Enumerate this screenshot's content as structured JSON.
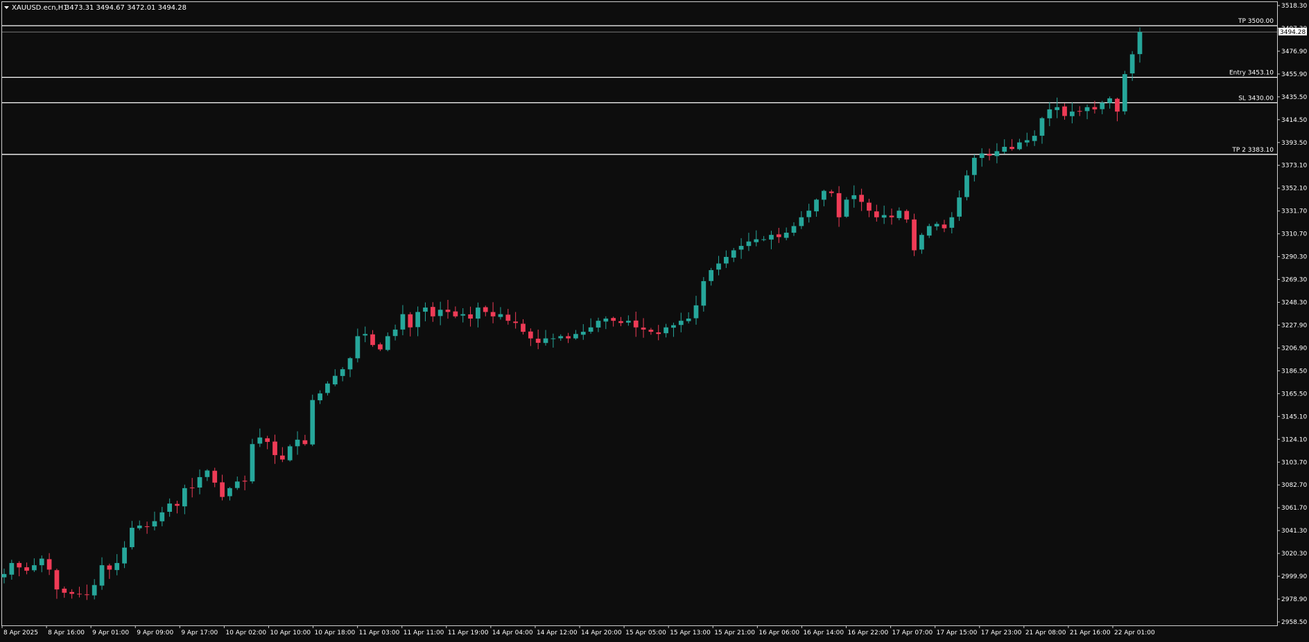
{
  "header": {
    "symbol": "XAUUSD.ecn,H1",
    "ohlc": "3473.31 3494.67 3472.01 3494.28"
  },
  "price_tag": "3494.28",
  "colors": {
    "background": "#0d0d0d",
    "bull": "#26a69a",
    "bear": "#ef3b56",
    "level_line": "#ffffff",
    "text": "#ffffff"
  },
  "chart_data": {
    "type": "candlestick",
    "symbol": "XAUUSD.ecn",
    "timeframe": "H1",
    "ylim": [
      2958.5,
      3518.3
    ],
    "y_ticks": [
      "3518.30",
      "3497.30",
      "3476.90",
      "3455.90",
      "3435.50",
      "3414.50",
      "3393.50",
      "3373.10",
      "3352.10",
      "3331.70",
      "3310.70",
      "3290.30",
      "3269.30",
      "3248.30",
      "3227.90",
      "3206.90",
      "3186.50",
      "3165.50",
      "3145.10",
      "3124.10",
      "3103.70",
      "3082.70",
      "3061.70",
      "3041.30",
      "3020.30",
      "2999.90",
      "2978.90",
      "2958.50"
    ],
    "x_ticks": [
      "8 Apr 2025",
      "8 Apr 16:00",
      "9 Apr 01:00",
      "9 Apr 09:00",
      "9 Apr 17:00",
      "10 Apr 02:00",
      "10 Apr 10:00",
      "10 Apr 18:00",
      "11 Apr 03:00",
      "11 Apr 11:00",
      "11 Apr 19:00",
      "14 Apr 04:00",
      "14 Apr 12:00",
      "14 Apr 20:00",
      "15 Apr 05:00",
      "15 Apr 13:00",
      "15 Apr 21:00",
      "16 Apr 06:00",
      "16 Apr 14:00",
      "16 Apr 22:00",
      "17 Apr 07:00",
      "17 Apr 15:00",
      "17 Apr 23:00",
      "21 Apr 08:00",
      "21 Apr 16:00",
      "22 Apr 01:00"
    ],
    "levels": [
      {
        "label": "TP 3500.00",
        "price": 3500.0
      },
      {
        "label": "Entry 3453.10",
        "price": 3453.1
      },
      {
        "label": "SL 3430.00",
        "price": 3430.0
      },
      {
        "label": "TP 2 3383.10",
        "price": 3383.1
      }
    ],
    "last_price": 3494.28,
    "close_path": [
      3002,
      3012,
      3008,
      3005,
      3010,
      3016,
      3006,
      2988,
      2985,
      2984,
      2984,
      2983,
      2992,
      3010,
      3006,
      3012,
      3026,
      3044,
      3046,
      3045,
      3050,
      3058,
      3066,
      3064,
      3080,
      3080,
      3090,
      3096,
      3085,
      3072,
      3080,
      3086,
      3086,
      3120,
      3126,
      3122,
      3110,
      3106,
      3118,
      3124,
      3120,
      3160,
      3166,
      3175,
      3182,
      3188,
      3198,
      3218,
      3220,
      3210,
      3206,
      3218,
      3224,
      3238,
      3226,
      3240,
      3244,
      3236,
      3242,
      3240,
      3236,
      3238,
      3234,
      3244,
      3240,
      3236,
      3238,
      3232,
      3230,
      3222,
      3216,
      3212,
      3216,
      3216,
      3218,
      3216,
      3220,
      3222,
      3226,
      3232,
      3234,
      3232,
      3230,
      3232,
      3226,
      3224,
      3222,
      3220,
      3226,
      3228,
      3232,
      3234,
      3246,
      3268,
      3278,
      3284,
      3290,
      3296,
      3300,
      3304,
      3306,
      3306,
      3310,
      3308,
      3312,
      3318,
      3326,
      3332,
      3342,
      3350,
      3348,
      3326,
      3342,
      3346,
      3340,
      3332,
      3326,
      3328,
      3326,
      3332,
      3324,
      3296,
      3310,
      3318,
      3320,
      3316,
      3326,
      3344,
      3364,
      3380,
      3384,
      3382,
      3386,
      3390,
      3388,
      3394,
      3396,
      3400,
      3416,
      3424,
      3426,
      3418,
      3422,
      3422,
      3426,
      3424,
      3430,
      3434,
      3422,
      3456,
      3474,
      3494.28
    ]
  }
}
